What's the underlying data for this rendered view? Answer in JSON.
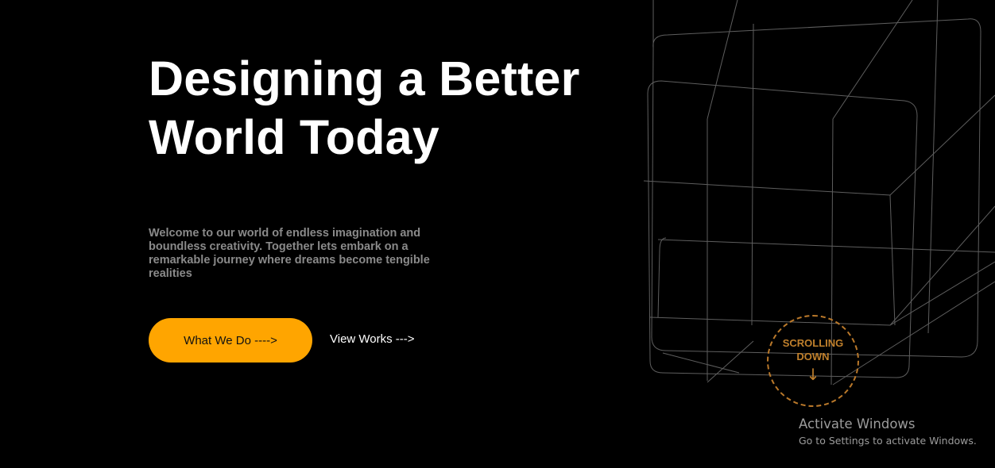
{
  "hero": {
    "title_line1": "Designing a Better",
    "title_line2": "World Today",
    "description": "Welcome to our world of endless imagination and boundless creativity. Together lets embark on a remarkable journey where dreams become tengible realities",
    "primary_button_label": "What We Do ---->",
    "secondary_link_label": "View Works --->"
  },
  "scroll_indicator": {
    "label": "SCROLLING\nDOWN",
    "arrow": "↓",
    "icon": "arrow-down-icon"
  },
  "watermark": {
    "title": "Activate Windows",
    "subtitle": "Go to Settings to activate Windows."
  },
  "colors": {
    "background": "#000000",
    "accent": "#ffa500",
    "heading": "#ffffff",
    "body_text": "#8a8a8a",
    "badge": "#c0802c",
    "wireframe": "#6a6a6a"
  }
}
